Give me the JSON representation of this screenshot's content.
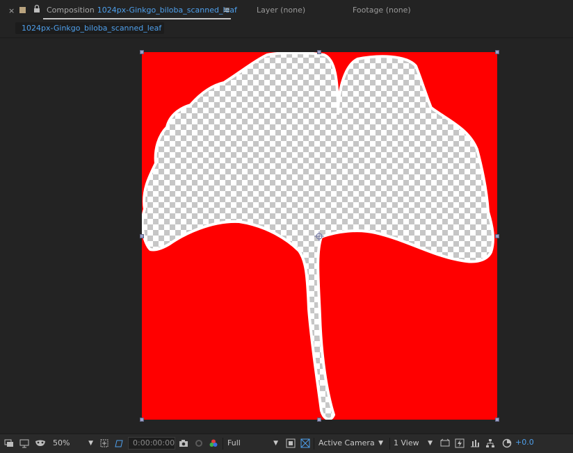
{
  "panel": {
    "close_glyph": "×",
    "comp_label": "Composition",
    "comp_name": "1024px-Ginkgo_biloba_scanned_leaf",
    "menu_glyph": "≡",
    "layer_tab": "Layer (none)",
    "footage_tab": "Footage (none)",
    "breadcrumb": "1024px-Ginkgo_biloba_scanned_leaf"
  },
  "viewer": {
    "background_color": "#ff0000",
    "transparency_grid": true
  },
  "bottom_bar": {
    "zoom": "50%",
    "timecode": "0:00:00:00",
    "resolution": "Full",
    "camera": "Active Camera",
    "views": "1 View",
    "exposure": "+0.0"
  },
  "icons": [
    "close-icon",
    "label-color-swatch",
    "lock-icon",
    "panel-menu-icon",
    "always-preview-icon",
    "monitor-icon",
    "mask-visibility-icon",
    "region-of-interest-icon",
    "transparency-grid-icon",
    "snapshot-icon",
    "show-snapshot-icon",
    "color-channels-icon",
    "fast-previews-icon",
    "toggle-grid-icon",
    "3d-view-icon",
    "timeline-icon",
    "comp-flowchart-icon",
    "reset-exposure-icon"
  ]
}
